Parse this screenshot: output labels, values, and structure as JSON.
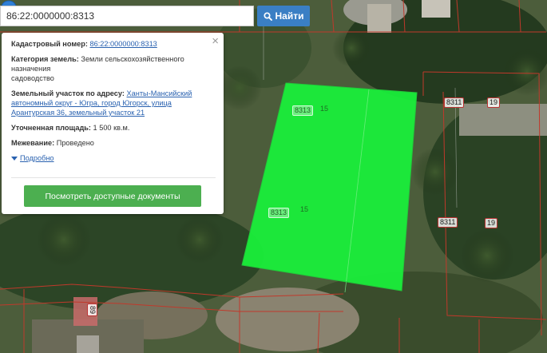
{
  "search": {
    "value": "86:22:0000000:8313",
    "button_label": "Найти",
    "button_icon": "search-icon"
  },
  "popup": {
    "close_symbol": "×",
    "cadastral_number_label": "Кадастровый номер:",
    "cadastral_number_value": "86:22:0000000:8313",
    "land_category_label": "Категория земель:",
    "land_category_value": "Земли сельскохозяйственного назначения",
    "land_use_value": "садоводство",
    "address_label": "Земельный участок по адресу:",
    "address_value": "Ханты-Мансийский автономный округ - Югра, город Югорск, улица Арантурская 36, земельный участок 21",
    "area_label": "Уточненная площадь:",
    "area_value": "1 500 кв.м.",
    "survey_label": "Межевание:",
    "survey_value": "Проведено",
    "details_link": "Подробно",
    "documents_button": "Посмотреть доступные документы"
  },
  "map": {
    "highlight_color": "#19f23a",
    "border_color": "#c0392b",
    "marker_color": "#2f7fd6",
    "plot_labels": [
      "8313",
      "15",
      "8313",
      "15",
      "8311",
      "19",
      "8311",
      "19",
      "89"
    ]
  }
}
